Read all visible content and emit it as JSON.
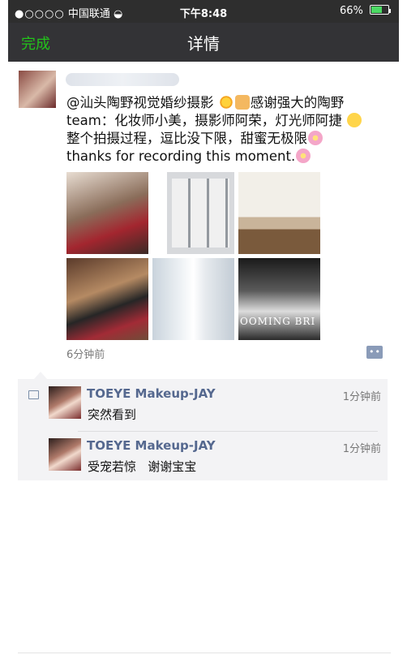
{
  "status_bar": {
    "signal": "●○○○○",
    "carrier": "中国联通",
    "wifi": "wifi-icon",
    "time": "下午8:48",
    "battery_percent": "66%",
    "battery_level": 0.66
  },
  "nav": {
    "done_label": "完成",
    "title": "详情"
  },
  "post": {
    "text_part1": "@汕头陶野视觉婚纱摄影",
    "text_part2": "感谢强大的陶野team：化妆师小美，摄影师阿荣，灯光师阿捷",
    "text_part3": "整个拍摄过程，逗比没下限，甜蜜无极限",
    "text_part4": "thanks for recording this moment.",
    "photo_caption": "OOMING BRI",
    "time": "6分钟前"
  },
  "comments": [
    {
      "name": "TOEYE Makeup-JAY",
      "time": "1分钟前",
      "text": "突然看到"
    },
    {
      "name": "TOEYE Makeup-JAY",
      "time": "1分钟前",
      "text": "受宠若惊   谢谢宝宝"
    }
  ],
  "colors": {
    "nav_bg": "#333336",
    "done_green": "#23c21b",
    "name_blue": "#55688f"
  }
}
